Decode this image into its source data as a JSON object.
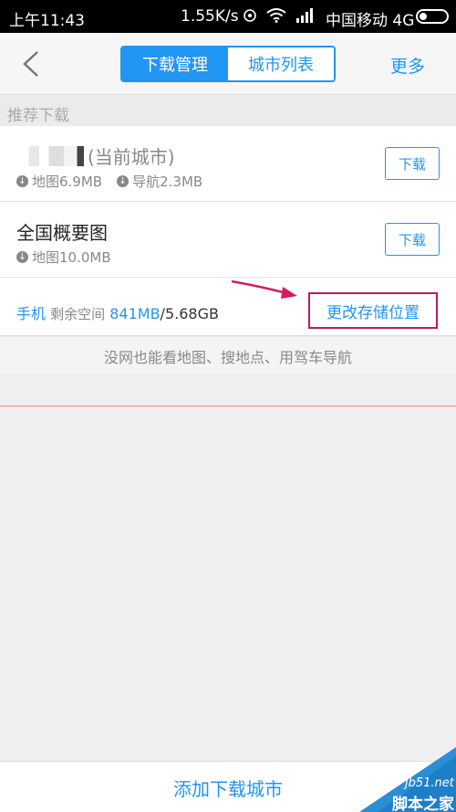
{
  "status_bar": {
    "time": "上午11:43",
    "speed": "1.55K/s",
    "carrier": "中国移动 4G"
  },
  "nav": {
    "tabs": [
      {
        "label": "下载管理",
        "active": true
      },
      {
        "label": "城市列表",
        "active": false
      }
    ],
    "more": "更多"
  },
  "section": {
    "title": "推荐下载"
  },
  "items": [
    {
      "title": "(当前城市)",
      "map": "地图6.9MB",
      "nav": "导航2.3MB",
      "button": "下载"
    },
    {
      "title": "全国概要图",
      "map": "地图10.0MB",
      "button": "下载"
    }
  ],
  "storage": {
    "device": "手机",
    "label": "剩余空间",
    "free": "841MB",
    "total": "/5.68GB",
    "change_button": "更改存储位置"
  },
  "tip": "没网也能看地图、搜地点、用驾车导航",
  "bottom": {
    "add_button": "添加下载城市"
  },
  "watermark": {
    "url": "jb51.net",
    "name": "脚本之家"
  },
  "colors": {
    "accent": "#2196f3",
    "highlight": "#c2185b"
  }
}
